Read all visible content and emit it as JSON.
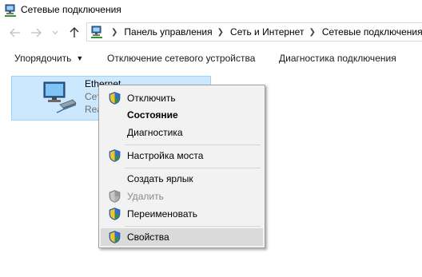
{
  "window": {
    "title": "Сетевые подключения",
    "icon": "network-connections-icon"
  },
  "nav": {
    "back_icon": "arrow-left-icon",
    "forward_icon": "arrow-right-icon",
    "recent_icon": "chevron-down-icon",
    "up_icon": "arrow-up-icon"
  },
  "address": {
    "crumbs": [
      "Панель управления",
      "Сеть и Интернет",
      "Сетевые подключения"
    ]
  },
  "commands": {
    "organize": "Упорядочить",
    "disable": "Отключение сетевого устройства",
    "diagnose": "Диагностика подключения"
  },
  "connection": {
    "name": "Ethernet",
    "line2": "Сеть",
    "line3": "Rea"
  },
  "context_menu": {
    "items": [
      {
        "label": "Отключить",
        "shield": true
      },
      {
        "label": "Состояние",
        "bold": true
      },
      {
        "label": "Диагностика"
      },
      {
        "label": "Настройка моста",
        "shield": true
      },
      {
        "label": "Создать ярлык"
      },
      {
        "label": "Удалить",
        "shield": true,
        "disabled": true
      },
      {
        "label": "Переименовать",
        "shield": true
      },
      {
        "label": "Свойства",
        "shield": true,
        "highlighted": true
      }
    ]
  },
  "colors": {
    "selection": "#cce8ff",
    "selection_border": "#99d1ff",
    "menu_bg": "#f2f2f2",
    "menu_highlight": "#dadada"
  }
}
